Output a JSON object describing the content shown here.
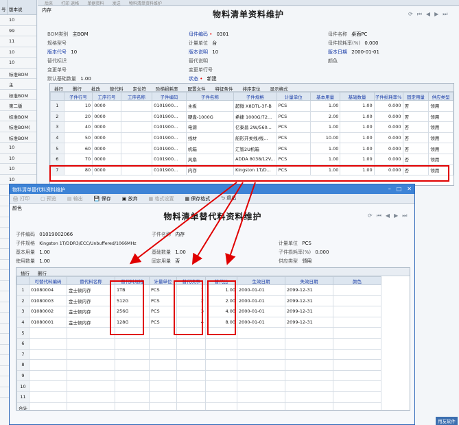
{
  "left_strip": {
    "header": [
      "号",
      "版本说"
    ],
    "rows": [
      "10",
      "99",
      "11",
      "10",
      "10",
      "标准BOM",
      "主",
      "标准BOM",
      "第二版",
      "标准BOM",
      "标准BOM(",
      "标准BOM",
      "10",
      "10",
      "10",
      "10",
      "10",
      "10",
      "10",
      "10",
      "10",
      "10",
      "10",
      "10",
      "10",
      "10",
      "10",
      "10",
      "10",
      "10",
      "10",
      "10",
      "10",
      "10",
      "10",
      "10"
    ]
  },
  "main": {
    "toolbar_faded": [
      "后来",
      "打印 退格",
      "单据资料",
      "发送",
      "物料清单资料维护"
    ],
    "inventory_tab": "内存",
    "title": "物料清单资料维护",
    "form": {
      "bom_type_label": "BOM类别",
      "bom_type": "主BOM",
      "spec_label": "规格型号",
      "spec": "",
      "ver_code_label": "版本代号",
      "ver_code": "10",
      "sub_flag_label": "替代标识",
      "sub_flag": "",
      "change_no_label": "变更单号",
      "change_no": "",
      "base_qty_label": "默认基础数量",
      "base_qty": "1.00",
      "parent_code_label": "母件编码",
      "parent_code": "0301",
      "unit_label": "计量单位",
      "unit": "台",
      "ver_desc_label": "版本说明",
      "ver_desc": "10",
      "sub_desc_label": "替代说明",
      "sub_desc": "",
      "change_line_label": "变更单行号",
      "change_line": "",
      "status_label": "状态",
      "status": "新建",
      "parent_name_label": "母件名称",
      "parent_name": "桌面PC",
      "parent_loss_label": "母件损耗率(%)",
      "parent_loss": "0.000",
      "ver_date_label": "版本日期",
      "ver_date": "2000-01-01",
      "color_label": "颜色",
      "color": ""
    },
    "grid_toolbar": [
      "插行",
      "删行",
      "批改",
      "替代料",
      "定位符",
      "阶梯损耗率",
      "配置文件",
      "特征条件",
      "排序定位",
      "显示格式"
    ],
    "grid_headers": [
      "",
      "子件行号",
      "工序行号",
      "工序名称",
      "子件编码",
      "子件名称",
      "子件规格",
      "计量单位",
      "基本用量",
      "基础数量",
      "子件损耗率%",
      "固定用量",
      "供应类型"
    ],
    "grid_rows": [
      [
        "1",
        "10",
        "0000",
        "",
        "0101900...",
        "主板",
        "超微 X8DTL-3F-B",
        "PCS",
        "1.00",
        "1.00",
        "0.000",
        "否",
        "领用"
      ],
      [
        "2",
        "20",
        "0000",
        "",
        "0101900...",
        "硬盘-1000G",
        "希捷 1000G/72...",
        "PCS",
        "2.00",
        "1.00",
        "0.000",
        "否",
        "领用"
      ],
      [
        "3",
        "40",
        "0000",
        "",
        "0101900...",
        "电源",
        "亿泰昌 2W/560...",
        "PCS",
        "1.00",
        "1.00",
        "0.000",
        "否",
        "领用"
      ],
      [
        "4",
        "50",
        "0000",
        "",
        "0101900...",
        "线材",
        "船形开关线/线...",
        "PCS",
        "10.00",
        "1.00",
        "0.000",
        "否",
        "领用"
      ],
      [
        "5",
        "60",
        "0000",
        "",
        "0101900...",
        "机箱",
        "汇智2U机箱",
        "PCS",
        "1.00",
        "1.00",
        "0.000",
        "否",
        "领用"
      ],
      [
        "6",
        "70",
        "0000",
        "",
        "0101900...",
        "风扇",
        "ADDA 8038/12V...",
        "PCS",
        "1.00",
        "1.00",
        "0.000",
        "否",
        "领用"
      ],
      [
        "7",
        "80",
        "0000",
        "",
        "0101900...",
        "内存",
        "Kingston 1T/D...",
        "PCS",
        "1.00",
        "1.00",
        "0.000",
        "否",
        "领用"
      ]
    ]
  },
  "dialog": {
    "window_title": "物料清单替代料资料维护",
    "toolbar": [
      "打印",
      "预览",
      "输出",
      "保存",
      "放弃",
      "格式设置",
      "保存格式",
      "退出"
    ],
    "color_label": "颜色",
    "title": "物料清单替代料资料维护",
    "form": {
      "child_code_label": "子件编码",
      "child_code": "01019002066",
      "child_spec_label": "子件规格",
      "child_spec": "Kingston 1T/DDR3/ECC/Unbuffered/1066MHz",
      "base_use_label": "基本用量",
      "base_use": "1.00",
      "use_qty_label": "使用数量",
      "use_qty": "1.00",
      "child_name_label": "子件名称",
      "child_name": "内存",
      "base_qty_label": "基础数量",
      "base_qty": "1.00",
      "fixed_label": "固定用量",
      "fixed": "否",
      "unit_label": "计量单位",
      "unit": "PCS",
      "loss_label": "子件损耗率(%)",
      "loss": "0.000",
      "supply_label": "供应类型",
      "supply": "领用"
    },
    "grid_toolbar": [
      "插行",
      "删行"
    ],
    "grid_headers": [
      "",
      "可替代料编码",
      "替代料名称",
      "替代料规格",
      "计量单位",
      "替代次序",
      "替代比",
      "生效日期",
      "失效日期",
      "颜色"
    ],
    "grid_rows": [
      [
        "1",
        "01080004",
        "金士顿内存",
        "1TB",
        "PCS",
        "1",
        "1.00",
        "2000-01-01",
        "2099-12-31",
        ""
      ],
      [
        "2",
        "01080003",
        "金士顿内存",
        "512G",
        "PCS",
        "2",
        "2.00",
        "2000-01-01",
        "2099-12-31",
        ""
      ],
      [
        "3",
        "01080002",
        "金士顿内存",
        "256G",
        "PCS",
        "3",
        "4.00",
        "2000-01-01",
        "2099-12-31",
        ""
      ],
      [
        "4",
        "01080001",
        "金士顿内存",
        "128G",
        "PCS",
        "4",
        "8.00",
        "2000-01-01",
        "2099-12-31",
        ""
      ],
      [
        "5",
        "",
        "",
        "",
        "",
        "",
        "",
        "",
        "",
        ""
      ],
      [
        "6",
        "",
        "",
        "",
        "",
        "",
        "",
        "",
        "",
        ""
      ],
      [
        "7",
        "",
        "",
        "",
        "",
        "",
        "",
        "",
        "",
        ""
      ],
      [
        "8",
        "",
        "",
        "",
        "",
        "",
        "",
        "",
        "",
        ""
      ],
      [
        "9",
        "",
        "",
        "",
        "",
        "",
        "",
        "",
        "",
        ""
      ],
      [
        "10",
        "",
        "",
        "",
        "",
        "",
        "",
        "",
        "",
        ""
      ],
      [
        "11",
        "",
        "",
        "",
        "",
        "",
        "",
        "",
        "",
        ""
      ],
      [
        "合计",
        "",
        "",
        "",
        "",
        "",
        "",
        "",
        "",
        ""
      ]
    ]
  },
  "statusbar_text": "用友软件",
  "colors": {
    "highlight": "#e00000",
    "titlebar": "#3d83d6",
    "link_blue": "#1b3ea8"
  }
}
